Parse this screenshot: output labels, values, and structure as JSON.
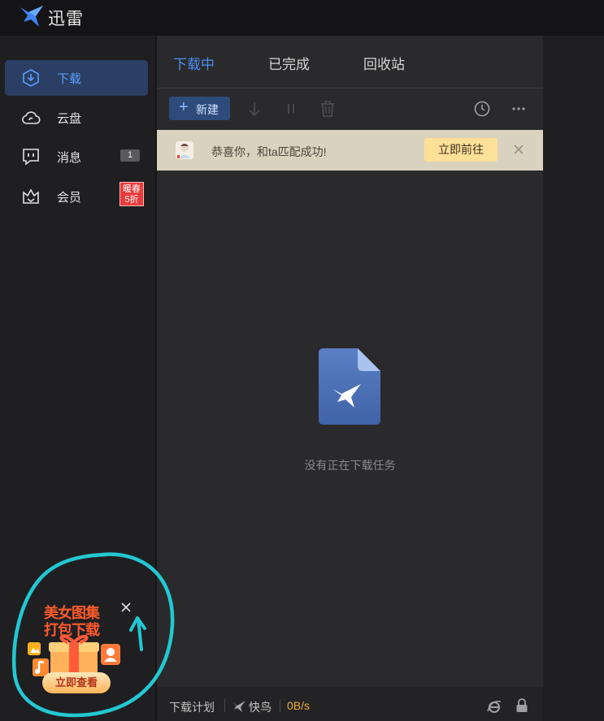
{
  "app": {
    "title": "迅雷"
  },
  "sidebar": {
    "items": [
      {
        "label": "下载",
        "icon": "download-circle-icon",
        "active": true
      },
      {
        "label": "云盘",
        "icon": "cloud-icon"
      },
      {
        "label": "消息",
        "icon": "message-icon",
        "badge": "1"
      },
      {
        "label": "会员",
        "icon": "crown-icon",
        "promo": [
          "暖春",
          "5折"
        ]
      }
    ]
  },
  "tabs": [
    {
      "label": "下载中",
      "active": true
    },
    {
      "label": "已完成"
    },
    {
      "label": "回收站"
    }
  ],
  "toolbar": {
    "new_label": "新建",
    "icons": [
      "download-arrow-icon",
      "pause-icon",
      "trash-icon",
      "clock-icon",
      "more-icon"
    ]
  },
  "notification": {
    "text": "恭喜你，和ta匹配成功!",
    "button": "立即前往"
  },
  "empty_state": {
    "text": "没有正在下载任务"
  },
  "statusbar": {
    "plan": "下载计划",
    "bird": "快鸟",
    "speed": "0B/s"
  },
  "ad": {
    "title_line1": "美女图集",
    "title_line2": "打包下载",
    "button": "立即查看"
  },
  "colors": {
    "accent": "#4d8ff5",
    "active_nav_bg": "#2a3f63",
    "notify_bg": "#d9d2bf",
    "notify_btn": "#ffe098",
    "speed": "#f0b030",
    "annotation": "#22c8d2"
  }
}
